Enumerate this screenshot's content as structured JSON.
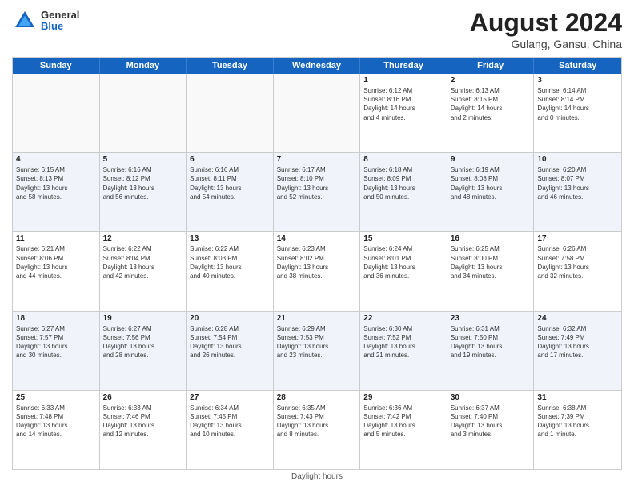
{
  "header": {
    "logo_general": "General",
    "logo_blue": "Blue",
    "title": "August 2024",
    "location": "Gulang, Gansu, China"
  },
  "weekdays": [
    "Sunday",
    "Monday",
    "Tuesday",
    "Wednesday",
    "Thursday",
    "Friday",
    "Saturday"
  ],
  "footer": "Daylight hours",
  "weeks": [
    [
      {
        "day": "",
        "info": "",
        "empty": true
      },
      {
        "day": "",
        "info": "",
        "empty": true
      },
      {
        "day": "",
        "info": "",
        "empty": true
      },
      {
        "day": "",
        "info": "",
        "empty": true
      },
      {
        "day": "1",
        "info": "Sunrise: 6:12 AM\nSunset: 8:16 PM\nDaylight: 14 hours\nand 4 minutes.",
        "empty": false
      },
      {
        "day": "2",
        "info": "Sunrise: 6:13 AM\nSunset: 8:15 PM\nDaylight: 14 hours\nand 2 minutes.",
        "empty": false
      },
      {
        "day": "3",
        "info": "Sunrise: 6:14 AM\nSunset: 8:14 PM\nDaylight: 14 hours\nand 0 minutes.",
        "empty": false
      }
    ],
    [
      {
        "day": "4",
        "info": "Sunrise: 6:15 AM\nSunset: 8:13 PM\nDaylight: 13 hours\nand 58 minutes.",
        "empty": false
      },
      {
        "day": "5",
        "info": "Sunrise: 6:16 AM\nSunset: 8:12 PM\nDaylight: 13 hours\nand 56 minutes.",
        "empty": false
      },
      {
        "day": "6",
        "info": "Sunrise: 6:16 AM\nSunset: 8:11 PM\nDaylight: 13 hours\nand 54 minutes.",
        "empty": false
      },
      {
        "day": "7",
        "info": "Sunrise: 6:17 AM\nSunset: 8:10 PM\nDaylight: 13 hours\nand 52 minutes.",
        "empty": false
      },
      {
        "day": "8",
        "info": "Sunrise: 6:18 AM\nSunset: 8:09 PM\nDaylight: 13 hours\nand 50 minutes.",
        "empty": false
      },
      {
        "day": "9",
        "info": "Sunrise: 6:19 AM\nSunset: 8:08 PM\nDaylight: 13 hours\nand 48 minutes.",
        "empty": false
      },
      {
        "day": "10",
        "info": "Sunrise: 6:20 AM\nSunset: 8:07 PM\nDaylight: 13 hours\nand 46 minutes.",
        "empty": false
      }
    ],
    [
      {
        "day": "11",
        "info": "Sunrise: 6:21 AM\nSunset: 8:06 PM\nDaylight: 13 hours\nand 44 minutes.",
        "empty": false
      },
      {
        "day": "12",
        "info": "Sunrise: 6:22 AM\nSunset: 8:04 PM\nDaylight: 13 hours\nand 42 minutes.",
        "empty": false
      },
      {
        "day": "13",
        "info": "Sunrise: 6:22 AM\nSunset: 8:03 PM\nDaylight: 13 hours\nand 40 minutes.",
        "empty": false
      },
      {
        "day": "14",
        "info": "Sunrise: 6:23 AM\nSunset: 8:02 PM\nDaylight: 13 hours\nand 38 minutes.",
        "empty": false
      },
      {
        "day": "15",
        "info": "Sunrise: 6:24 AM\nSunset: 8:01 PM\nDaylight: 13 hours\nand 36 minutes.",
        "empty": false
      },
      {
        "day": "16",
        "info": "Sunrise: 6:25 AM\nSunset: 8:00 PM\nDaylight: 13 hours\nand 34 minutes.",
        "empty": false
      },
      {
        "day": "17",
        "info": "Sunrise: 6:26 AM\nSunset: 7:58 PM\nDaylight: 13 hours\nand 32 minutes.",
        "empty": false
      }
    ],
    [
      {
        "day": "18",
        "info": "Sunrise: 6:27 AM\nSunset: 7:57 PM\nDaylight: 13 hours\nand 30 minutes.",
        "empty": false
      },
      {
        "day": "19",
        "info": "Sunrise: 6:27 AM\nSunset: 7:56 PM\nDaylight: 13 hours\nand 28 minutes.",
        "empty": false
      },
      {
        "day": "20",
        "info": "Sunrise: 6:28 AM\nSunset: 7:54 PM\nDaylight: 13 hours\nand 26 minutes.",
        "empty": false
      },
      {
        "day": "21",
        "info": "Sunrise: 6:29 AM\nSunset: 7:53 PM\nDaylight: 13 hours\nand 23 minutes.",
        "empty": false
      },
      {
        "day": "22",
        "info": "Sunrise: 6:30 AM\nSunset: 7:52 PM\nDaylight: 13 hours\nand 21 minutes.",
        "empty": false
      },
      {
        "day": "23",
        "info": "Sunrise: 6:31 AM\nSunset: 7:50 PM\nDaylight: 13 hours\nand 19 minutes.",
        "empty": false
      },
      {
        "day": "24",
        "info": "Sunrise: 6:32 AM\nSunset: 7:49 PM\nDaylight: 13 hours\nand 17 minutes.",
        "empty": false
      }
    ],
    [
      {
        "day": "25",
        "info": "Sunrise: 6:33 AM\nSunset: 7:48 PM\nDaylight: 13 hours\nand 14 minutes.",
        "empty": false
      },
      {
        "day": "26",
        "info": "Sunrise: 6:33 AM\nSunset: 7:46 PM\nDaylight: 13 hours\nand 12 minutes.",
        "empty": false
      },
      {
        "day": "27",
        "info": "Sunrise: 6:34 AM\nSunset: 7:45 PM\nDaylight: 13 hours\nand 10 minutes.",
        "empty": false
      },
      {
        "day": "28",
        "info": "Sunrise: 6:35 AM\nSunset: 7:43 PM\nDaylight: 13 hours\nand 8 minutes.",
        "empty": false
      },
      {
        "day": "29",
        "info": "Sunrise: 6:36 AM\nSunset: 7:42 PM\nDaylight: 13 hours\nand 5 minutes.",
        "empty": false
      },
      {
        "day": "30",
        "info": "Sunrise: 6:37 AM\nSunset: 7:40 PM\nDaylight: 13 hours\nand 3 minutes.",
        "empty": false
      },
      {
        "day": "31",
        "info": "Sunrise: 6:38 AM\nSunset: 7:39 PM\nDaylight: 13 hours\nand 1 minute.",
        "empty": false
      }
    ]
  ]
}
